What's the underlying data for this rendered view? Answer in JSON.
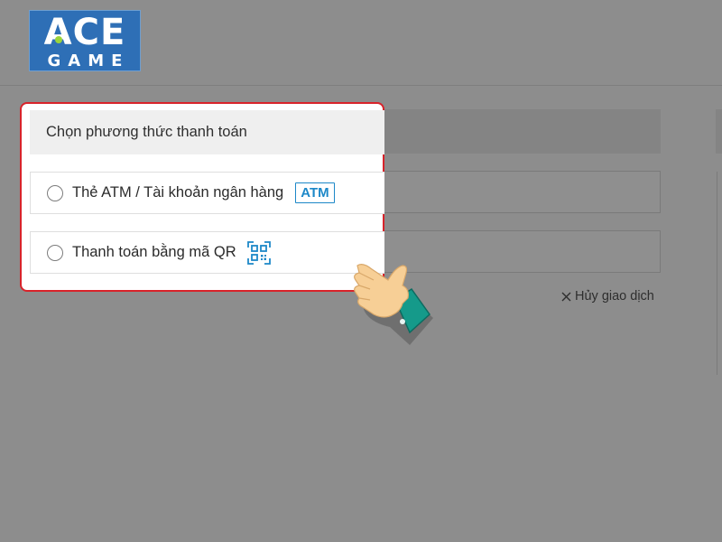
{
  "logo": {
    "top_text": "ACE",
    "bottom_text": "GAME",
    "brand_color": "#2e6fb6"
  },
  "payment": {
    "title": "Chọn phương thức thanh toán",
    "options": [
      {
        "label": "Thẻ ATM / Tài khoản ngân hàng",
        "badge": "ATM",
        "icon": "atm-badge"
      },
      {
        "label": "Thanh toán bằng mã QR",
        "icon": "qr-code-icon"
      }
    ],
    "highlight_color": "#d8232a"
  },
  "cancel": {
    "label": "Hủy giao dịch",
    "icon": "close-icon"
  },
  "overlay": {
    "pointer_icon": "pointing-hand-icon"
  }
}
